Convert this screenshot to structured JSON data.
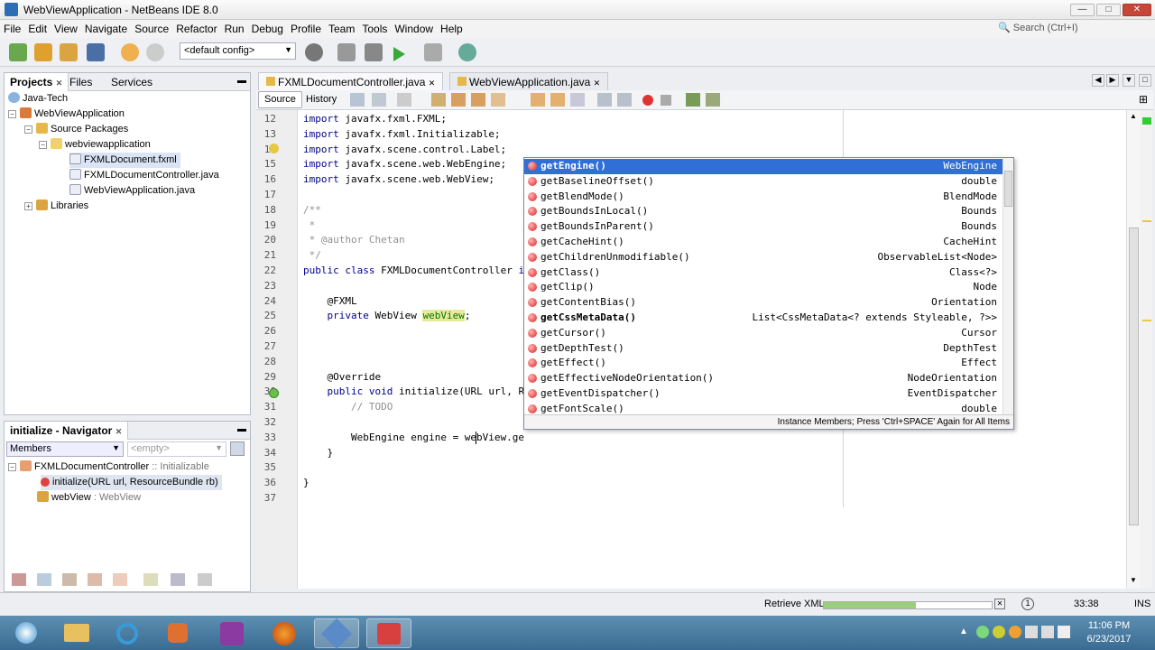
{
  "window": {
    "title": "WebViewApplication - NetBeans IDE 8.0",
    "minimize": "—",
    "maximize": "□",
    "close": "✕"
  },
  "menubar": {
    "items": [
      "File",
      "Edit",
      "View",
      "Navigate",
      "Source",
      "Refactor",
      "Run",
      "Debug",
      "Profile",
      "Team",
      "Tools",
      "Window",
      "Help"
    ]
  },
  "search": {
    "placeholder": "Search (Ctrl+I)"
  },
  "toolbar": {
    "config": "<default config>"
  },
  "projects_panel": {
    "tabs": [
      "Projects",
      "Files",
      "Services"
    ],
    "tree": [
      {
        "label": "Java-Tech",
        "icon": "globe-icon"
      },
      {
        "label": "WebViewApplication",
        "icon": "project-icon"
      },
      {
        "label": "Source Packages",
        "icon": "package-folder-icon"
      },
      {
        "label": "webviewapplication",
        "icon": "package-icon"
      },
      {
        "label": "FXMLDocument.fxml",
        "icon": "fxml-file-icon"
      },
      {
        "label": "FXMLDocumentController.java",
        "icon": "java-file-icon"
      },
      {
        "label": "WebViewApplication.java",
        "icon": "java-file-icon"
      },
      {
        "label": "Libraries",
        "icon": "libraries-icon"
      }
    ]
  },
  "navigator": {
    "title": "initialize - Navigator",
    "filter": "Members",
    "empty": "<empty>",
    "class_name": "FXMLDocumentController",
    "class_suffix": ":: Initializable",
    "method": "initialize(URL url, ResourceBundle rb)",
    "field": "webView",
    "field_type": ": WebView"
  },
  "editor": {
    "tabs": [
      "FXMLDocumentController.java",
      "WebViewApplication.java"
    ],
    "source_btn": "Source",
    "history_btn": "History",
    "lines": [
      {
        "n": "12",
        "t": "import javafx.fxml.FXML;"
      },
      {
        "n": "13",
        "t": "import javafx.fxml.Initializable;"
      },
      {
        "n": "14",
        "t": "import javafx.scene.control.Label;"
      },
      {
        "n": "15",
        "t": "import javafx.scene.web.WebEngine;"
      },
      {
        "n": "16",
        "t": "import javafx.scene.web.WebView;"
      },
      {
        "n": "17",
        "t": ""
      },
      {
        "n": "18",
        "t": "/**"
      },
      {
        "n": "19",
        "t": " *"
      },
      {
        "n": "20",
        "t": " * @author Chetan"
      },
      {
        "n": "21",
        "t": " */"
      },
      {
        "n": "22",
        "t": "public class FXMLDocumentController implements Initializable {"
      },
      {
        "n": "23",
        "t": ""
      },
      {
        "n": "24",
        "t": "    @FXML"
      },
      {
        "n": "25",
        "t": "    private WebView webView;"
      },
      {
        "n": "26",
        "t": ""
      },
      {
        "n": "27",
        "t": ""
      },
      {
        "n": "28",
        "t": ""
      },
      {
        "n": "29",
        "t": "    @Override"
      },
      {
        "n": "30",
        "t": "    public void initialize(URL url, ResourceBundle rb) {"
      },
      {
        "n": "31",
        "t": "        // TODO"
      },
      {
        "n": "32",
        "t": ""
      },
      {
        "n": "33",
        "t": "        WebEngine engine = webView.ge"
      },
      {
        "n": "34",
        "t": "    }"
      },
      {
        "n": "35",
        "t": ""
      },
      {
        "n": "36",
        "t": "}"
      },
      {
        "n": "37",
        "t": ""
      }
    ]
  },
  "completion": {
    "items": [
      {
        "name": "getEngine()",
        "type": "WebEngine",
        "bold": true
      },
      {
        "name": "getBaselineOffset()",
        "type": "double"
      },
      {
        "name": "getBlendMode()",
        "type": "BlendMode"
      },
      {
        "name": "getBoundsInLocal()",
        "type": "Bounds"
      },
      {
        "name": "getBoundsInParent()",
        "type": "Bounds"
      },
      {
        "name": "getCacheHint()",
        "type": "CacheHint"
      },
      {
        "name": "getChildrenUnmodifiable()",
        "type": "ObservableList<Node>"
      },
      {
        "name": "getClass()",
        "type": "Class<?>"
      },
      {
        "name": "getClip()",
        "type": "Node"
      },
      {
        "name": "getContentBias()",
        "type": "Orientation"
      },
      {
        "name": "getCssMetaData()",
        "type": "List<CssMetaData<? extends Styleable, ?>>",
        "bold": true
      },
      {
        "name": "getCursor()",
        "type": "Cursor"
      },
      {
        "name": "getDepthTest()",
        "type": "DepthTest"
      },
      {
        "name": "getEffect()",
        "type": "Effect"
      },
      {
        "name": "getEffectiveNodeOrientation()",
        "type": "NodeOrientation"
      },
      {
        "name": "getEventDispatcher()",
        "type": "EventDispatcher"
      },
      {
        "name": "getFontScale()",
        "type": "double"
      }
    ],
    "footer": "Instance Members; Press 'Ctrl+SPACE' Again for All Items"
  },
  "status": {
    "task": "Retrieve XML",
    "position": "33:38",
    "mode": "INS",
    "progress": 0.55
  },
  "taskbar": {
    "apps": [
      "windows-start-icon",
      "file-explorer-icon",
      "internet-explorer-icon",
      "media-player-icon",
      "teams-icon",
      "firefox-icon",
      "netbeans-icon",
      "ccleaner-icon"
    ],
    "time": "11:06 PM",
    "date": "6/23/2017"
  },
  "colors": {
    "selection": "#2f6fd6",
    "keyword": "#00008b",
    "comment": "#909090",
    "field_highlight": "#e9e99c"
  }
}
